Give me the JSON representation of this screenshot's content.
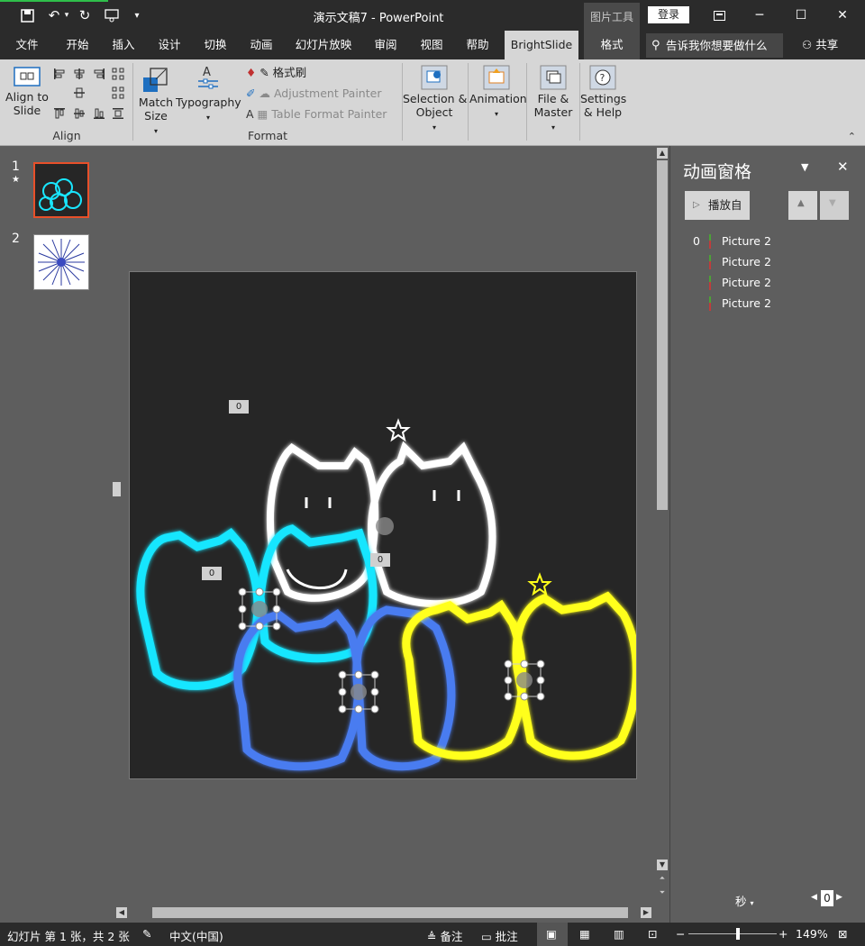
{
  "titlebar": {
    "title": "演示文稿7  -  PowerPoint",
    "context_group": "图片工具",
    "login_label": "登录"
  },
  "tabs": {
    "items": [
      "文件",
      "开始",
      "插入",
      "设计",
      "切换",
      "动画",
      "幻灯片放映",
      "审阅",
      "视图",
      "帮助",
      "BrightSlide",
      "格式"
    ],
    "active": "BrightSlide",
    "tell_me": "告诉我你想要做什么",
    "share": "共享"
  },
  "ribbon": {
    "align_to_slide": "Align to\nSlide",
    "align_group": "Align",
    "match_size": "Match\nSize",
    "typography": "Typography",
    "format_painter": "格式刷",
    "adjustment_painter": "Adjustment Painter",
    "table_format_painter": "Table Format Painter",
    "format_group": "Format",
    "selection_object": "Selection &\nObject",
    "animation": "Animation",
    "file_master": "File &\nMaster",
    "settings_help": "Settings\n& Help"
  },
  "thumbnails": [
    {
      "number": "1",
      "star": "★"
    },
    {
      "number": "2",
      "star": ""
    }
  ],
  "slide": {
    "tags": [
      "0",
      "0",
      "0"
    ]
  },
  "animation_pane": {
    "title": "动画窗格",
    "play_from": "播放自",
    "items": [
      {
        "index": "0",
        "name": "Picture 2"
      },
      {
        "index": "",
        "name": "Picture 2"
      },
      {
        "index": "",
        "name": "Picture 2"
      },
      {
        "index": "",
        "name": "Picture 2"
      }
    ],
    "time_unit": "秒",
    "zoom_value": "0"
  },
  "status": {
    "slide_info": "幻灯片 第 1 张，共 2 张",
    "language": "中文(中国)",
    "notes": "备注",
    "comments": "批注",
    "zoom": "149%"
  },
  "colors": {
    "cyan": "#19e6ff",
    "yellow": "#ffff1a",
    "blue": "#4a7cf0",
    "white": "#ffffff"
  }
}
